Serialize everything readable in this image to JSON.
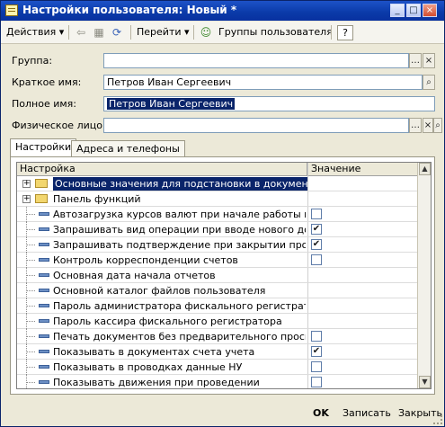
{
  "window": {
    "title": "Настройки пользователя: Новый *"
  },
  "toolbar": {
    "actions_label": "Действия",
    "goto_label": "Перейти",
    "user_groups_label": "Группы пользователя",
    "help_label": "?"
  },
  "form": {
    "group_label": "Группа:",
    "group_value": "",
    "short_name_label": "Краткое имя:",
    "short_name_value": "Петров Иван Сергеевич",
    "full_name_label": "Полное имя:",
    "full_name_value": "Петров Иван Сергеевич",
    "person_label": "Физическое лицо:",
    "person_value": ""
  },
  "tabs": [
    {
      "label": "Настройки",
      "active": true
    },
    {
      "label": "Адреса и телефоны",
      "active": false
    }
  ],
  "grid": {
    "columns": [
      "Настройка",
      "Значение"
    ],
    "rows": [
      {
        "name": "Основные значения для подстановки в документы и...",
        "type": "group",
        "checked": null,
        "selected": true
      },
      {
        "name": "Панель функций",
        "type": "group",
        "checked": null,
        "selected": false
      },
      {
        "name": "Автозагрузка курсов валют при начале работы прог...",
        "type": "item",
        "checked": false,
        "selected": false
      },
      {
        "name": "Запрашивать вид операции при вводе нового докум...",
        "type": "item",
        "checked": true,
        "selected": false
      },
      {
        "name": "Запрашивать подтверждение при закрытии програм...",
        "type": "item",
        "checked": true,
        "selected": false
      },
      {
        "name": "Контроль корреспонденции счетов",
        "type": "item",
        "checked": false,
        "selected": false
      },
      {
        "name": "Основная дата начала отчетов",
        "type": "item",
        "checked": null,
        "selected": false
      },
      {
        "name": "Основной каталог файлов пользователя",
        "type": "item",
        "checked": null,
        "selected": false
      },
      {
        "name": "Пароль администратора фискального регистратора",
        "type": "item",
        "checked": null,
        "selected": false
      },
      {
        "name": "Пароль кассира фискального регистратора",
        "type": "item",
        "checked": null,
        "selected": false
      },
      {
        "name": "Печать документов без предварительного просмотра",
        "type": "item",
        "checked": false,
        "selected": false
      },
      {
        "name": "Показывать в документах счета учета",
        "type": "item",
        "checked": true,
        "selected": false
      },
      {
        "name": "Показывать в проводках данные НУ",
        "type": "item",
        "checked": false,
        "selected": false
      },
      {
        "name": "Показывать движения при проведении",
        "type": "item",
        "checked": false,
        "selected": false
      }
    ]
  },
  "footer": {
    "ok_label": "OK",
    "save_label": "Записать",
    "close_label": "Закрыть"
  },
  "colors": {
    "title_bar": "#0a3aa8",
    "selection": "#0a246a",
    "window_bg": "#ece9d8"
  }
}
